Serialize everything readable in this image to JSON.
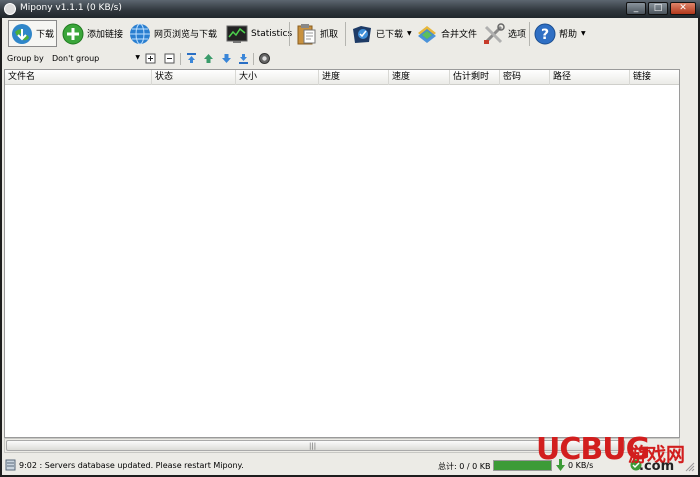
{
  "window": {
    "title": "Mipony v1.1.1 (0 KB/s)",
    "controls": {
      "minimize": "_",
      "maximize": "□",
      "close": "✕"
    }
  },
  "toolbar": {
    "download": "下载",
    "add_links": "添加链接",
    "browse_download": "网页浏览与下载",
    "statistics": "Statistics",
    "capture": "抓取",
    "downloaded": "已下载",
    "merge_files": "合并文件",
    "options": "选项",
    "help": "帮助"
  },
  "groupbar": {
    "label": "Group by",
    "selected": "Don't group"
  },
  "table": {
    "columns": [
      "文件名",
      "状态",
      "大小",
      "进度",
      "速度",
      "估计剩时",
      "密码",
      "路径",
      "链接"
    ]
  },
  "status": {
    "message": "9:02 : Servers database updated. Please restart Mipony.",
    "total": "总计: 0 / 0 KB",
    "progress": 1.0,
    "speed": "0 KB/s"
  },
  "watermark": {
    "brand": "UCBUG",
    "cn": "游戏网",
    "domain": ".com"
  },
  "colors": {
    "accent_green": "#3c9b37",
    "watermark_red": "#d21e1e"
  }
}
